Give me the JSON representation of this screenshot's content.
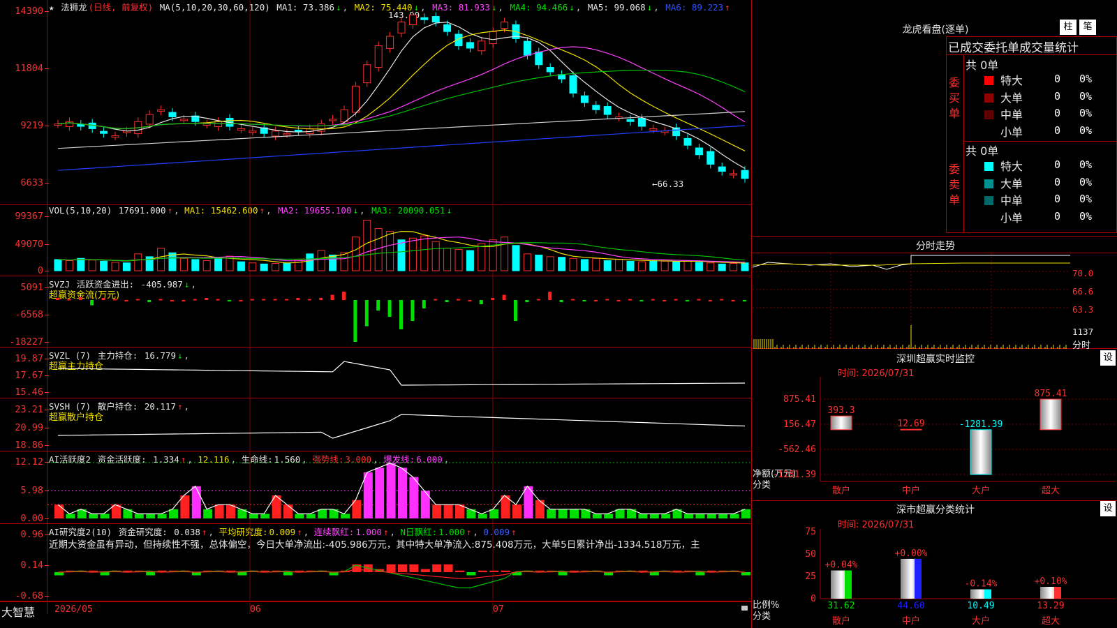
{
  "stock": {
    "name": "法狮龙",
    "period": "(日线, 前复权)",
    "star": "★"
  },
  "main_panel": {
    "ma_label": "MA(5,10,20,30,60,120)",
    "ma": [
      {
        "label": "MA1:",
        "value": "73.386",
        "arrow": "↓",
        "color": "#e6e6e6"
      },
      {
        "label": "MA2:",
        "value": "75.440",
        "arrow": "↓",
        "color": "#f0e000"
      },
      {
        "label": "MA3:",
        "value": "81.933",
        "arrow": "↓",
        "color": "#ff40ff"
      },
      {
        "label": "MA4:",
        "value": "94.466",
        "arrow": "↓",
        "color": "#00e000"
      },
      {
        "label": "MA5:",
        "value": "99.068",
        "arrow": "↓",
        "color": "#e6e6e6"
      },
      {
        "label": "MA6:",
        "value": "89.223",
        "arrow": "↑",
        "color": "#3050ff"
      }
    ],
    "yticks": [
      "14390",
      "11804",
      "9219",
      "6633"
    ],
    "high_label": "143.90",
    "low_label": "←66.33"
  },
  "vol_panel": {
    "label": "VOL(5,10,20)",
    "value": "17691.000",
    "value_arrow": "↑",
    "ma": [
      {
        "label": "MA1:",
        "value": "15462.600",
        "arrow": "↑",
        "color": "#f0e000"
      },
      {
        "label": "MA2:",
        "value": "19655.100",
        "arrow": "↓",
        "color": "#ff40ff"
      },
      {
        "label": "MA3:",
        "value": "20090.051",
        "arrow": "↓",
        "color": "#00e000"
      }
    ],
    "yticks": [
      "99367",
      "49070",
      "0"
    ]
  },
  "svzj_panel": {
    "label": "SVZJ",
    "title": "活跃资金进出:",
    "value": "-405.987",
    "arrow": "↓",
    "subtitle": "超赢资金流(万元)",
    "yticks": [
      "5091",
      "-6568",
      "-18227"
    ]
  },
  "svzl_panel": {
    "label": "SVZL (7)",
    "title": "主力持仓:",
    "value": "16.779",
    "arrow": "↓",
    "subtitle": "超赢主力持仓",
    "yticks": [
      "19.87",
      "17.67",
      "15.46"
    ]
  },
  "svsh_panel": {
    "label": "SVSH (7)",
    "title": "散户持仓:",
    "value": "20.117",
    "arrow": "↑",
    "subtitle": "超赢散户持仓",
    "yticks": [
      "23.21",
      "20.99",
      "18.86"
    ]
  },
  "ai_active_panel": {
    "label": "AI活跃度2",
    "title": "资金活跃度:",
    "value": "1.334",
    "arrow": "↑",
    "value2": "12.116",
    "life_label": "生命线:",
    "life_value": "1.560",
    "strong_label": "强势线:",
    "strong_value": "3.000",
    "burst_label": "爆发线:",
    "burst_value": "6.000",
    "yticks": [
      "12.12",
      "5.98",
      "0.00"
    ]
  },
  "ai_research_panel": {
    "label": "AI研究度2(10)",
    "title": "资金研究度:",
    "value": "0.038",
    "arrow": "↑",
    "avg_label": "平均研究度:",
    "avg_value": "0.009",
    "lian_label": "连续飘红:",
    "lian_value": "1.000",
    "nday_label": "N日飘红:",
    "nday_value": "1.000",
    "last_value": "0.009",
    "commentary": "近期大资金虽有异动，但持续性不强，总体偏空，今日大单净流出:-405.986万元，其中特大单净流入:875.408万元，大单5日累计净出-1334.518万元，主",
    "yticks": [
      "0.96",
      "0.14",
      "-0.68"
    ]
  },
  "date_axis": {
    "labels": [
      "2026/05",
      "06",
      "07"
    ],
    "brand": "大智慧"
  },
  "right": {
    "longhu_title": "龙虎看盘(逐单)",
    "btn_zhu": "柱",
    "btn_bi": "笔",
    "order_title": "已成交委托单成交量统计",
    "buy_side": "委买单",
    "sell_side": "委卖单",
    "buy_total": "共 0单",
    "sell_total": "共 0单",
    "buy_rows": [
      {
        "label": "特大",
        "count": "0",
        "pct": "0%",
        "color": "#ff0000"
      },
      {
        "label": "大单",
        "count": "0",
        "pct": "0%",
        "color": "#900000"
      },
      {
        "label": "中单",
        "count": "0",
        "pct": "0%",
        "color": "#600000"
      },
      {
        "label": "小单",
        "count": "0",
        "pct": "0%",
        "color": ""
      }
    ],
    "sell_rows": [
      {
        "label": "特大",
        "count": "0",
        "pct": "0%",
        "color": "#00ffff"
      },
      {
        "label": "大单",
        "count": "0",
        "pct": "0%",
        "color": "#009090"
      },
      {
        "label": "中单",
        "count": "0",
        "pct": "0%",
        "color": "#006868"
      },
      {
        "label": "小单",
        "count": "0",
        "pct": "0%",
        "color": ""
      }
    ],
    "intraday_title": "分时走势",
    "intraday_yticks": [
      "70.0",
      "66.6",
      "63.3"
    ],
    "intraday_vol": "1137",
    "intraday_vol_unit": "分时",
    "sz_monitor": {
      "title": "深圳超赢实时监控",
      "set_btn": "设",
      "time": "时间: 2026/07/31",
      "yticks": [
        "875.41",
        "156.47",
        "-562.46",
        "-1281.39"
      ],
      "ylabel_top": "净额(万元)",
      "ylabel_bottom": "分类",
      "categories": [
        "散户",
        "中户",
        "大户",
        "超大"
      ],
      "values": [
        393.3,
        12.69,
        -1281.39,
        875.41
      ],
      "value_labels": [
        "393.3",
        "12.69",
        "-1281.39",
        "875.41"
      ]
    },
    "sz_stats": {
      "title": "深市超赢分类统计",
      "set_btn": "设",
      "time": "时间: 2026/07/31",
      "yticks": [
        "75",
        "50",
        "25",
        "0"
      ],
      "ylabel_top": "比例%",
      "ylabel_bottom": "分类",
      "categories": [
        "散户",
        "中户",
        "大户",
        "超大"
      ],
      "values": [
        31.62,
        44.6,
        10.49,
        13.29
      ],
      "change_labels": [
        "+0.04%",
        "+0.00%",
        "-0.14%",
        "+0.10%"
      ],
      "colors": [
        "#00e000",
        "#2020ff",
        "#00ffff",
        "#ff3030"
      ]
    }
  }
}
